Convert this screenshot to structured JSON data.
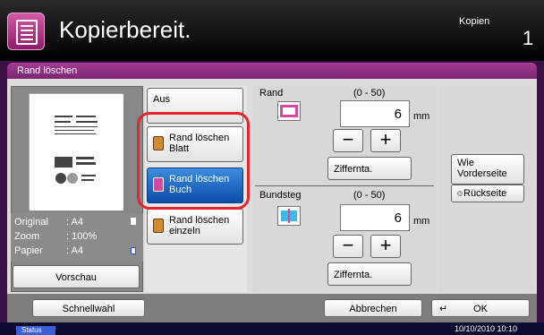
{
  "header": {
    "status_title": "Kopierbereit.",
    "mode": "Kopien",
    "screen_number": "1",
    "icon": "copy-document-icon"
  },
  "function": {
    "title": "Rand löschen"
  },
  "preview": {
    "rows": [
      {
        "label": "Original",
        "value": ": A4"
      },
      {
        "label": "Zoom",
        "value": ": 100%"
      },
      {
        "label": "Papier",
        "value": ": A4"
      }
    ],
    "button": "Vorschau"
  },
  "options": {
    "off": "Aus",
    "sheet": "Rand löschen Blatt",
    "book": "Rand löschen Buch",
    "single": "Rand löschen einzeln",
    "selected": "book"
  },
  "border": {
    "label": "Rand",
    "range": "(0 - 50)",
    "value": "6",
    "unit": "mm",
    "minus": "−",
    "plus": "+",
    "keypad": "Ziffernta."
  },
  "gutter": {
    "label": "Bundsteg",
    "range": "(0 - 50)",
    "value": "6",
    "unit": "mm",
    "minus": "−",
    "plus": "+",
    "keypad": "Ziffernta."
  },
  "page_side": {
    "front": "Wie Vorderseite",
    "back": "Rückseite"
  },
  "footer": {
    "quick": "Schnellwahl",
    "cancel": "Abbrechen",
    "ok": "OK"
  },
  "status": {
    "tab": "Status",
    "datetime": "10/10/2010  10:10"
  },
  "colors": {
    "accent_purple": "#7c2472",
    "selected_blue": "#0a4da8",
    "highlight_red": "#e8232a"
  }
}
